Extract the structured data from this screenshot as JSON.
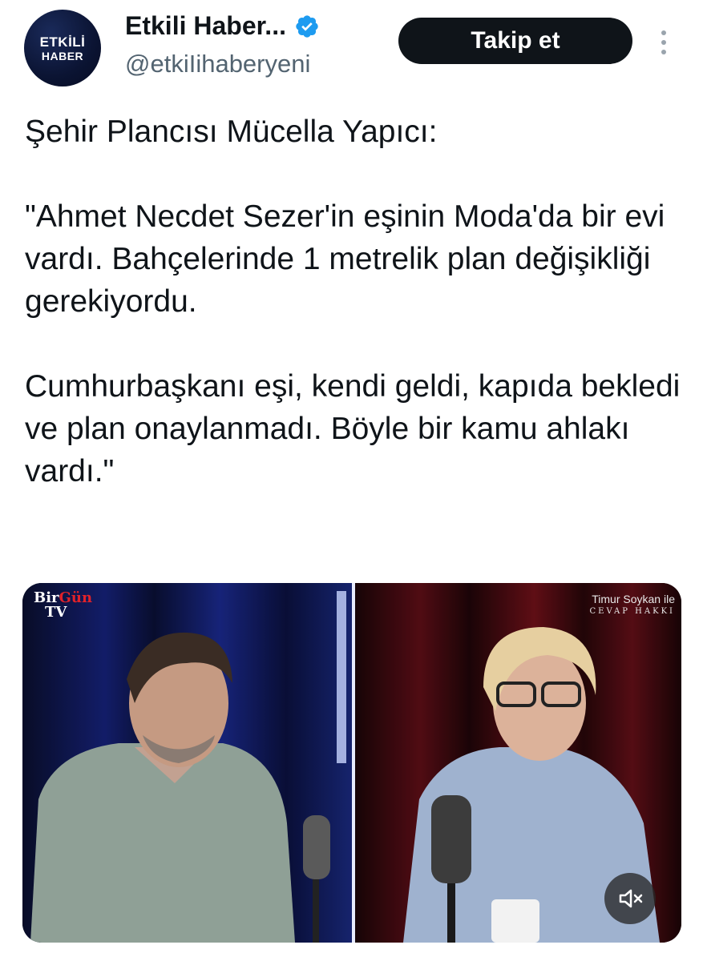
{
  "author": {
    "avatar_line1": "ETKİLİ",
    "avatar_line2": "HABER",
    "display_name": "Etkili Haber...",
    "handle": "@etkiIihaberyeni",
    "verified_icon": "verified-badge-icon"
  },
  "actions": {
    "follow_label": "Takip et",
    "more_icon": "more-vertical-icon"
  },
  "tweet": {
    "line_title": "Şehir Plancısı Mücella Yapıcı:",
    "paragraph1": "\"Ahmet Necdet Sezer'in eşinin Moda'da bir evi vardı. Bahçelerinde 1 metrelik plan değişikliği gerekiyordu.",
    "paragraph2": "Cumhurbaşkanı eşi, kendi geldi, kapıda bekledi ve plan onaylanmadı. Böyle bir kamu ahlakı vardı.\""
  },
  "media": {
    "left_brand_a": "Bir",
    "left_brand_b": "Gün",
    "left_brand_c": "TV",
    "right_brand_line1": "Timur Soykan ile",
    "right_brand_line2": "CEVAP HAKKI",
    "mute_icon": "volume-muted-icon"
  },
  "colors": {
    "text": "#0f1419",
    "secondary": "#536471",
    "button_bg": "#0f1419",
    "verified": "#1d9bf0",
    "brand_red": "#e0222a"
  }
}
